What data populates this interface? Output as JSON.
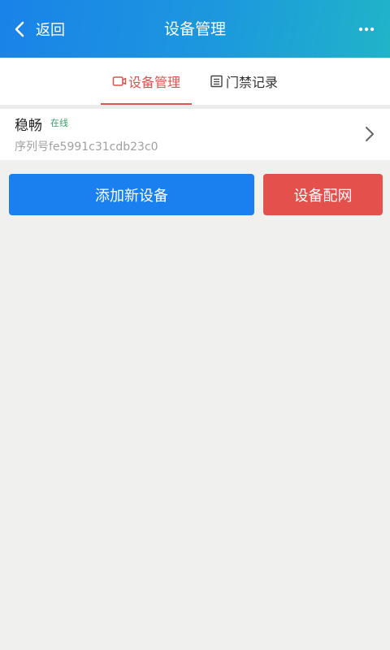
{
  "header": {
    "back_label": "返回",
    "title": "设备管理",
    "more_icon": "more-icon"
  },
  "tabs": [
    {
      "label": "设备管理",
      "icon": "camera-icon",
      "active": true
    },
    {
      "label": "门禁记录",
      "icon": "record-icon",
      "active": false
    }
  ],
  "device": {
    "name": "稳畅",
    "status": "在线",
    "serial": "序列号fe5991c31cdb23c0"
  },
  "buttons": {
    "add_label": "添加新设备",
    "network_label": "设备配网"
  },
  "colors": {
    "header_start": "#1a82e8",
    "header_end": "#20b4c8",
    "active_tab": "#e05650",
    "status_online": "#3aa06a",
    "add_button": "#1a80f0",
    "network_button": "#e4504c",
    "background": "#f0f1ef"
  }
}
